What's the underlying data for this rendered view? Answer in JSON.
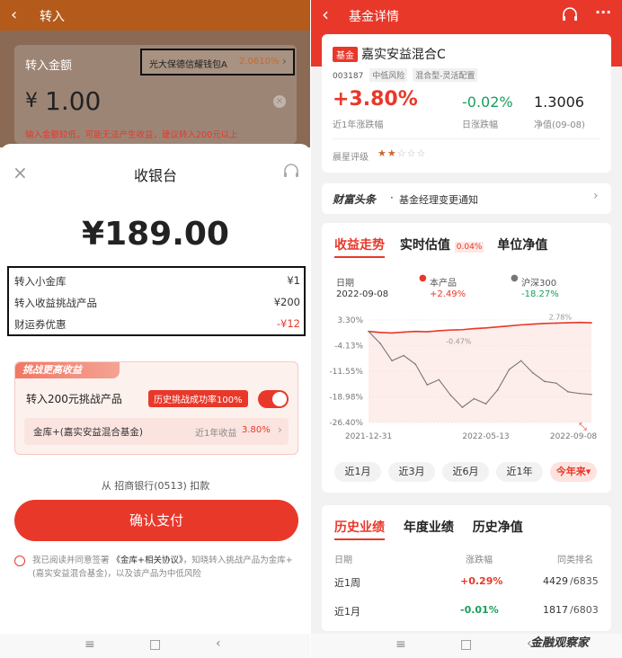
{
  "left": {
    "topbar": {
      "title": "转入"
    },
    "background": {
      "amount_label": "转入金额",
      "product_name": "光大保德信耀钱包A",
      "product_yield": "2.0610%",
      "amount_prefix": "¥",
      "amount_value": "1.00",
      "warning": "输入金额较低，可能无法产生收益，建议转入200元以上"
    },
    "cashier": {
      "title": "收银台",
      "total": "¥189.00",
      "lines": [
        {
          "label": "转入小金库",
          "value": "¥1",
          "color": "#333333"
        },
        {
          "label": "转入收益挑战产品",
          "value": "¥200",
          "color": "#333333"
        },
        {
          "label": "财运券优惠",
          "value": "-¥12",
          "color": "#e8382a"
        }
      ],
      "challenge": {
        "header": "挑战更高收益",
        "label": "转入200元挑战产品",
        "badge": "历史挑战成功率100%",
        "fund_name": "金库+(嘉实安益混合基金)",
        "fund_yield_label": "近1年收益",
        "fund_yield_value": "3.80%",
        "toggle_on": true
      },
      "bank": "从 招商银行(0513) 扣款",
      "confirm": "确认支付",
      "agreement_prefix": "我已阅读并同意签署",
      "agreement_link": "《金库+相关协议》",
      "agreement_rest": "，知晓转入挑战产品为金库+(嘉实安益混合基金)，以及该产品为中低风险"
    }
  },
  "right": {
    "topbar": {
      "title": "基金详情"
    },
    "fund": {
      "tag": "基金",
      "name": "嘉实安益混合C",
      "code": "003187",
      "risk": "中低风险",
      "category": "混合型-灵活配置",
      "year_return": "+3.80%",
      "year_return_label": "近1年涨跌幅",
      "day_change": "-0.02%",
      "day_change_label": "日涨跌幅",
      "nav": "1.3006",
      "nav_label": "净值(09-08)",
      "rating_label": "晨星评级",
      "rating_stars": 2,
      "rating_max": 5
    },
    "news": {
      "source": "财富头条",
      "dot": "·",
      "text": "基金经理变更通知"
    },
    "chart_tabs": [
      "收益走势",
      "实时估值",
      "单位净值"
    ],
    "realtime_badge": "0.04%",
    "legend": {
      "date_label": "日期",
      "date_value": "2022-09-08",
      "product_label": "本产品",
      "product_value": "+2.49%",
      "index_label": "沪深300",
      "index_value": "-18.27%"
    },
    "annotations": {
      "product_end": "2.78%",
      "product_low": "-0.47%"
    },
    "ranges": [
      "近1月",
      "近3月",
      "近6月",
      "近1年",
      "今年来▾"
    ],
    "perf_tabs": [
      "历史业绩",
      "年度业绩",
      "历史净值"
    ],
    "perf_headers": [
      "日期",
      "涨跌幅",
      "同类排名"
    ],
    "perf_rows": [
      {
        "period": "近1周",
        "change": "+0.29%",
        "rank": "4429",
        "total": "/6835",
        "color": "#e8382a"
      },
      {
        "period": "近1月",
        "change": "-0.01%",
        "rank": "1817",
        "total": "/6803",
        "color": "#17a05d"
      }
    ]
  },
  "watermark": "金融观察家",
  "chart_data": {
    "type": "line",
    "x": [
      "2021-12-31",
      "2022-01-14",
      "2022-01-28",
      "2022-02-11",
      "2022-02-25",
      "2022-03-11",
      "2022-03-25",
      "2022-04-08",
      "2022-04-22",
      "2022-05-06",
      "2022-05-13",
      "2022-05-27",
      "2022-06-10",
      "2022-06-24",
      "2022-07-08",
      "2022-07-22",
      "2022-08-05",
      "2022-08-19",
      "2022-09-02",
      "2022-09-08"
    ],
    "series": [
      {
        "name": "本产品",
        "color": "#e8382a",
        "values": [
          0.0,
          -0.3,
          -0.47,
          -0.2,
          0.0,
          -0.1,
          0.2,
          0.4,
          0.5,
          0.8,
          1.0,
          1.3,
          1.6,
          1.9,
          2.1,
          2.3,
          2.4,
          2.5,
          2.6,
          2.49
        ]
      },
      {
        "name": "沪深300",
        "color": "#777777",
        "values": [
          0.0,
          -3.5,
          -8.5,
          -7.0,
          -9.5,
          -15.5,
          -14.0,
          -18.5,
          -22.0,
          -19.5,
          -21.0,
          -17.0,
          -11.0,
          -8.5,
          -12.0,
          -14.5,
          -15.0,
          -17.5,
          -18.0,
          -18.27
        ]
      }
    ],
    "yticks": [
      "3.30%",
      "-4.13%",
      "-11.55%",
      "-18.98%",
      "-26.40%"
    ],
    "ylim": [
      -26.4,
      3.3
    ],
    "xticks": [
      "2021-12-31",
      "2022-05-13",
      "2022-09-08"
    ],
    "grid": true
  }
}
